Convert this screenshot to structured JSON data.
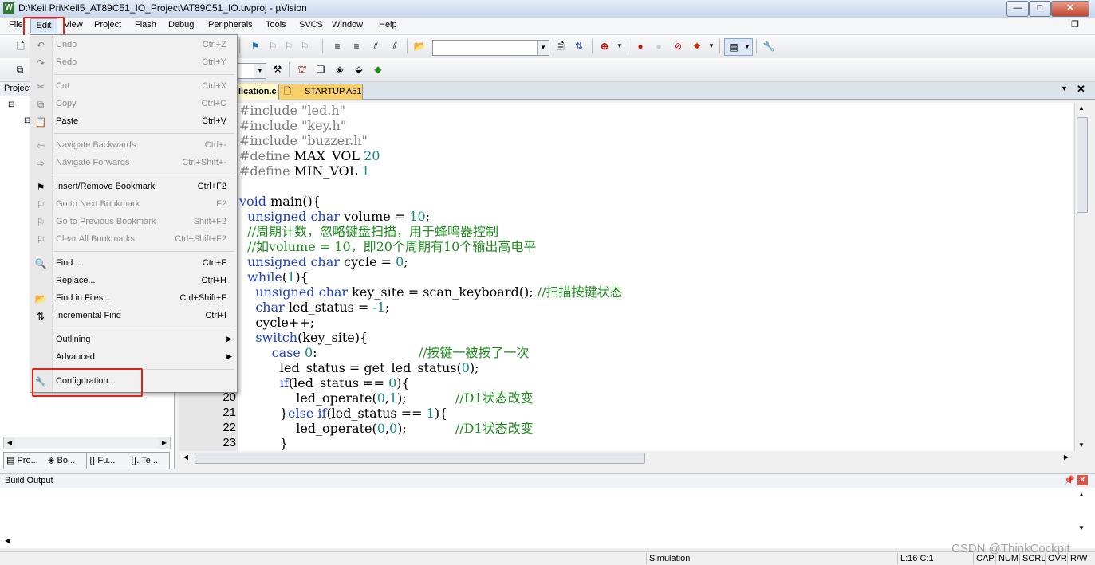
{
  "window": {
    "title": "D:\\Keil Pri\\Keil5_AT89C51_IO_Project\\AT89C51_IO.uvproj - µVision",
    "app_icon": "W",
    "buttons": {
      "minimize": "—",
      "maximize": "□",
      "close": "✕"
    }
  },
  "menubar": {
    "items": [
      "File",
      "Edit",
      "View",
      "Project",
      "Flash",
      "Debug",
      "Peripherals",
      "Tools",
      "SVCS",
      "Window",
      "Help"
    ]
  },
  "toolbar": {
    "find_value": "",
    "target_value": ""
  },
  "project_panel": {
    "header": "Project",
    "tabs": [
      "Pro...",
      "Bo...",
      "{} Fu...",
      "{}. Te..."
    ]
  },
  "editor": {
    "tabs": [
      "lication.c",
      "STARTUP.A51"
    ],
    "line_numbers": [
      "20",
      "21",
      "22",
      "23"
    ],
    "code": [
      {
        "t": [
          {
            "c": "pp",
            "s": "#include "
          },
          {
            "c": "str",
            "s": "\"led.h\""
          }
        ]
      },
      {
        "t": [
          {
            "c": "pp",
            "s": "#include "
          },
          {
            "c": "str",
            "s": "\"key.h\""
          }
        ]
      },
      {
        "t": [
          {
            "c": "pp",
            "s": "#include "
          },
          {
            "c": "str",
            "s": "\"buzzer.h\""
          }
        ]
      },
      {
        "t": [
          {
            "c": "pp",
            "s": "#define "
          },
          {
            "c": "",
            "s": "MAX_VOL "
          },
          {
            "c": "num",
            "s": "20"
          }
        ]
      },
      {
        "t": [
          {
            "c": "pp",
            "s": "#define "
          },
          {
            "c": "",
            "s": "MIN_VOL "
          },
          {
            "c": "num",
            "s": "1"
          }
        ]
      },
      {
        "t": []
      },
      {
        "t": [
          {
            "c": "kw",
            "s": "void "
          },
          {
            "c": "",
            "s": "main(){"
          }
        ]
      },
      {
        "t": [
          {
            "c": "",
            "s": "  "
          },
          {
            "c": "kw",
            "s": "unsigned char "
          },
          {
            "c": "",
            "s": "volume = "
          },
          {
            "c": "num",
            "s": "10"
          },
          {
            "c": "",
            "s": ";"
          }
        ]
      },
      {
        "t": [
          {
            "c": "cm",
            "s": "  //周期计数，忽略键盘扫描，用于蜂鸣器控制"
          }
        ]
      },
      {
        "t": [
          {
            "c": "cm",
            "s": "  //如volume = 10，即20个周期有10个输出高电平"
          }
        ]
      },
      {
        "t": [
          {
            "c": "",
            "s": "  "
          },
          {
            "c": "kw",
            "s": "unsigned char "
          },
          {
            "c": "",
            "s": "cycle = "
          },
          {
            "c": "num",
            "s": "0"
          },
          {
            "c": "",
            "s": ";"
          }
        ]
      },
      {
        "t": [
          {
            "c": "",
            "s": "  "
          },
          {
            "c": "kw",
            "s": "while"
          },
          {
            "c": "",
            "s": "("
          },
          {
            "c": "num",
            "s": "1"
          },
          {
            "c": "",
            "s": "){"
          }
        ]
      },
      {
        "t": [
          {
            "c": "",
            "s": "    "
          },
          {
            "c": "kw",
            "s": "unsigned char "
          },
          {
            "c": "",
            "s": "key_site = scan_keyboard(); "
          },
          {
            "c": "cm",
            "s": "//扫描按键状态"
          }
        ]
      },
      {
        "t": [
          {
            "c": "",
            "s": "    "
          },
          {
            "c": "kw",
            "s": "char "
          },
          {
            "c": "",
            "s": "led_status = "
          },
          {
            "c": "num",
            "s": "-1"
          },
          {
            "c": "",
            "s": ";"
          }
        ]
      },
      {
        "t": [
          {
            "c": "",
            "s": "    cycle++;"
          }
        ]
      },
      {
        "t": [
          {
            "c": "",
            "s": "    "
          },
          {
            "c": "kw",
            "s": "switch"
          },
          {
            "c": "",
            "s": "(key_site){"
          }
        ]
      },
      {
        "t": [
          {
            "c": "",
            "s": "        "
          },
          {
            "c": "kw",
            "s": "case "
          },
          {
            "c": "num",
            "s": "0"
          },
          {
            "c": "",
            "s": ":                         "
          },
          {
            "c": "cm",
            "s": "//按键一被按了一次"
          }
        ]
      },
      {
        "t": [
          {
            "c": "",
            "s": "          led_status = get_led_status("
          },
          {
            "c": "num",
            "s": "0"
          },
          {
            "c": "",
            "s": ");"
          }
        ]
      },
      {
        "t": [
          {
            "c": "",
            "s": "          "
          },
          {
            "c": "kw",
            "s": "if"
          },
          {
            "c": "",
            "s": "(led_status == "
          },
          {
            "c": "num",
            "s": "0"
          },
          {
            "c": "",
            "s": "){"
          }
        ]
      },
      {
        "t": [
          {
            "c": "",
            "s": "              led_operate("
          },
          {
            "c": "num",
            "s": "0"
          },
          {
            "c": "",
            "s": ","
          },
          {
            "c": "num",
            "s": "1"
          },
          {
            "c": "",
            "s": ");            "
          },
          {
            "c": "cm",
            "s": "//D1状态改变"
          }
        ]
      },
      {
        "t": [
          {
            "c": "",
            "s": "          }"
          },
          {
            "c": "kw",
            "s": "else if"
          },
          {
            "c": "",
            "s": "(led_status == "
          },
          {
            "c": "num",
            "s": "1"
          },
          {
            "c": "",
            "s": "){"
          }
        ]
      },
      {
        "t": [
          {
            "c": "",
            "s": "              led_operate("
          },
          {
            "c": "num",
            "s": "0"
          },
          {
            "c": "",
            "s": ","
          },
          {
            "c": "num",
            "s": "0"
          },
          {
            "c": "",
            "s": ");            "
          },
          {
            "c": "cm",
            "s": "//D1状态改变"
          }
        ]
      },
      {
        "t": [
          {
            "c": "",
            "s": "          }"
          }
        ]
      }
    ]
  },
  "edit_menu": {
    "items": [
      {
        "label": "Undo",
        "shortcut": "Ctrl+Z",
        "disabled": true,
        "icon": "undo-icon",
        "glyph": "↶"
      },
      {
        "label": "Redo",
        "shortcut": "Ctrl+Y",
        "disabled": true,
        "icon": "redo-icon",
        "glyph": "↷"
      },
      {
        "sep": true
      },
      {
        "label": "Cut",
        "shortcut": "Ctrl+X",
        "disabled": true,
        "icon": "cut-icon",
        "glyph": "✂"
      },
      {
        "label": "Copy",
        "shortcut": "Ctrl+C",
        "disabled": true,
        "icon": "copy-icon",
        "glyph": "⧉"
      },
      {
        "label": "Paste",
        "shortcut": "Ctrl+V",
        "disabled": false,
        "icon": "paste-icon",
        "glyph": "📋"
      },
      {
        "sep": true
      },
      {
        "label": "Navigate Backwards",
        "shortcut": "Ctrl+-",
        "disabled": true,
        "icon": "arrow-left-icon",
        "glyph": "⇦"
      },
      {
        "label": "Navigate Forwards",
        "shortcut": "Ctrl+Shift+-",
        "disabled": true,
        "icon": "arrow-right-icon",
        "glyph": "⇨"
      },
      {
        "sep": true
      },
      {
        "label": "Insert/Remove Bookmark",
        "shortcut": "Ctrl+F2",
        "disabled": false,
        "icon": "bookmark-flag-icon",
        "glyph": "⚑"
      },
      {
        "label": "Go to Next Bookmark",
        "shortcut": "F2",
        "disabled": true,
        "icon": "next-bookmark-icon",
        "glyph": "⚐"
      },
      {
        "label": "Go to Previous Bookmark",
        "shortcut": "Shift+F2",
        "disabled": true,
        "icon": "previous-bookmark-icon",
        "glyph": "⚐"
      },
      {
        "label": "Clear All Bookmarks",
        "shortcut": "Ctrl+Shift+F2",
        "disabled": true,
        "icon": "clear-bookmarks-icon",
        "glyph": "⚐"
      },
      {
        "sep": true
      },
      {
        "label": "Find...",
        "shortcut": "Ctrl+F",
        "disabled": false,
        "icon": "find-icon",
        "glyph": "🔍"
      },
      {
        "label": "Replace...",
        "shortcut": "Ctrl+H",
        "disabled": false,
        "icon": "",
        "glyph": ""
      },
      {
        "label": "Find in Files...",
        "shortcut": "Ctrl+Shift+F",
        "disabled": false,
        "icon": "find-in-files-icon",
        "glyph": "📂"
      },
      {
        "label": "Incremental Find",
        "shortcut": "Ctrl+I",
        "disabled": false,
        "icon": "incremental-find-icon",
        "glyph": "⇅"
      },
      {
        "sep": true
      },
      {
        "label": "Outlining",
        "shortcut": "",
        "disabled": false,
        "icon": "",
        "glyph": "",
        "submenu": true
      },
      {
        "label": "Advanced",
        "shortcut": "",
        "disabled": false,
        "icon": "",
        "glyph": "",
        "submenu": true
      },
      {
        "sep": true
      },
      {
        "label": "Configuration...",
        "shortcut": "",
        "disabled": false,
        "icon": "wrench-icon",
        "glyph": "🔧"
      }
    ]
  },
  "build_output": {
    "header": "Build Output"
  },
  "statusbar": {
    "mode": "Simulation",
    "position": "L:16 C:1",
    "indicators": [
      "CAP",
      "NUM",
      "SCRL",
      "OVR",
      "R/W"
    ]
  },
  "watermark": "CSDN @ThinkCockpit",
  "colors": {
    "highlight_box": "#e0201a",
    "keyword": "#2040d0",
    "comment": "#1f8c1f",
    "number": "#108a8a"
  }
}
